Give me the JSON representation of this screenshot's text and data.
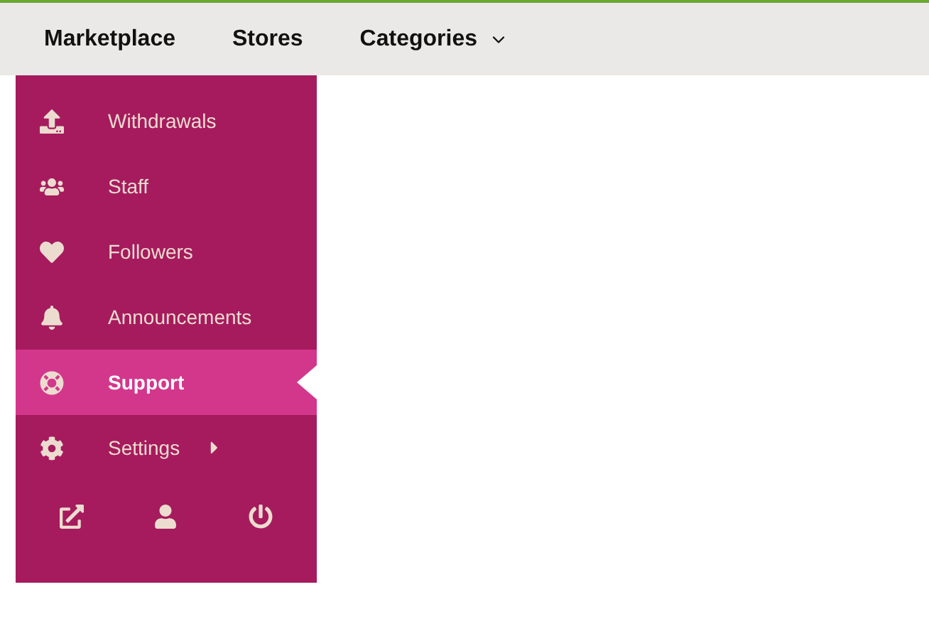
{
  "nav": {
    "items": [
      {
        "label": "Marketplace",
        "dropdown": false
      },
      {
        "label": "Stores",
        "dropdown": false
      },
      {
        "label": "Categories",
        "dropdown": true
      }
    ]
  },
  "sidebar": {
    "items": [
      {
        "label": "Withdrawals",
        "selected": false,
        "submenu": false
      },
      {
        "label": "Staff",
        "selected": false,
        "submenu": false
      },
      {
        "label": "Followers",
        "selected": false,
        "submenu": false
      },
      {
        "label": "Announcements",
        "selected": false,
        "submenu": false
      },
      {
        "label": "Support",
        "selected": true,
        "submenu": false
      },
      {
        "label": "Settings",
        "selected": false,
        "submenu": true
      }
    ]
  }
}
